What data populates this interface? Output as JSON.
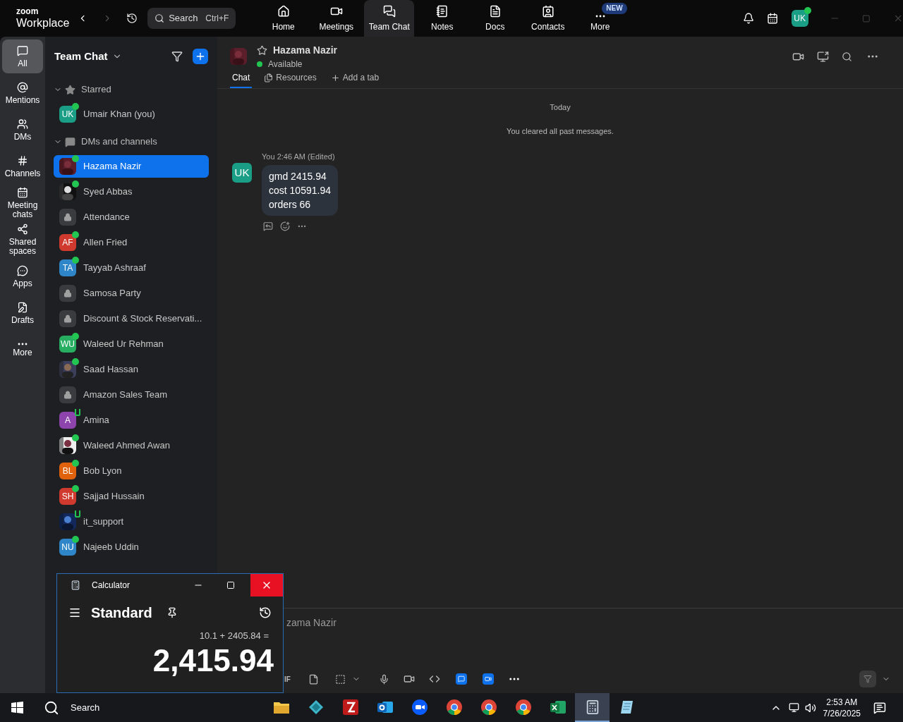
{
  "app": {
    "logo_top": "zoom",
    "logo_bottom": "Workplace"
  },
  "search": {
    "placeholder": "Search",
    "shortcut": "Ctrl+F"
  },
  "nav_tabs": [
    {
      "label": "Home",
      "selected": false
    },
    {
      "label": "Meetings",
      "selected": false
    },
    {
      "label": "Team Chat",
      "selected": true
    },
    {
      "label": "Notes",
      "selected": false
    },
    {
      "label": "Docs",
      "selected": false
    },
    {
      "label": "Contacts",
      "selected": false
    },
    {
      "label": "More",
      "selected": false,
      "badge": "NEW"
    }
  ],
  "profile": {
    "initials": "UK"
  },
  "rail": [
    {
      "label": "All",
      "selected": true
    },
    {
      "label": "Mentions",
      "selected": false
    },
    {
      "label": "DMs",
      "selected": false
    },
    {
      "label": "Channels",
      "selected": false
    },
    {
      "label": "Meeting chats",
      "selected": false
    },
    {
      "label": "Shared spaces",
      "selected": false
    },
    {
      "label": "Apps",
      "selected": false
    },
    {
      "label": "Drafts",
      "selected": false
    },
    {
      "label": "More",
      "selected": false
    }
  ],
  "sidebar": {
    "title": "Team Chat",
    "sections": [
      {
        "title": "Starred",
        "expanded": true,
        "items": [
          {
            "name": "Umair Khan (you)",
            "kind": "initials",
            "initials": "UK",
            "color": "#1a9e85",
            "online": true,
            "mobile": false,
            "selected": false
          }
        ]
      },
      {
        "title": "DMs and channels",
        "expanded": true,
        "items": [
          {
            "name": "Hazama Nazir",
            "online": true,
            "mobile": false,
            "selected": true
          },
          {
            "name": "Syed Abbas",
            "online": true,
            "mobile": false,
            "selected": false
          },
          {
            "name": "Attendance",
            "kind": "lock",
            "online": false,
            "mobile": false,
            "selected": false
          },
          {
            "name": "Allen Fried",
            "kind": "initials",
            "initials": "AF",
            "color": "#d0392e",
            "online": true,
            "mobile": false,
            "selected": false
          },
          {
            "name": "Tayyab Ashraaf",
            "kind": "initials",
            "initials": "TA",
            "color": "#2e86c8",
            "online": true,
            "mobile": false,
            "selected": false
          },
          {
            "name": "Samosa Party",
            "kind": "lock",
            "online": false,
            "mobile": false,
            "selected": false
          },
          {
            "name": "Discount & Stock Reservati...",
            "kind": "lock",
            "online": false,
            "mobile": false,
            "selected": false
          },
          {
            "name": "Waleed Ur Rehman",
            "kind": "initials",
            "initials": "WU",
            "color": "#27ae60",
            "online": true,
            "mobile": false,
            "selected": false
          },
          {
            "name": "Saad Hassan",
            "online": true,
            "mobile": false,
            "selected": false
          },
          {
            "name": "Amazon Sales Team",
            "kind": "lock",
            "online": false,
            "mobile": false,
            "selected": false
          },
          {
            "name": "Amina",
            "kind": "initials",
            "initials": "A",
            "color": "#8e44ad",
            "online": false,
            "mobile": true,
            "selected": false
          },
          {
            "name": "Waleed Ahmed Awan",
            "online": true,
            "mobile": false,
            "selected": false
          },
          {
            "name": "Bob Lyon",
            "kind": "initials",
            "initials": "BL",
            "color": "#e0620d",
            "online": true,
            "mobile": false,
            "selected": false
          },
          {
            "name": "Sajjad Hussain",
            "kind": "initials",
            "initials": "SH",
            "color": "#d0392e",
            "online": true,
            "mobile": false,
            "selected": false
          },
          {
            "name": "it_support",
            "online": false,
            "mobile": true,
            "selected": false
          },
          {
            "name": "Najeeb Uddin",
            "kind": "initials",
            "initials": "NU",
            "color": "#2e86c8",
            "online": true,
            "mobile": false,
            "selected": false
          }
        ]
      }
    ]
  },
  "chat": {
    "name": "Hazama Nazir",
    "presence": "Available",
    "starred": false,
    "tabs": [
      {
        "label": "Chat",
        "selected": true
      },
      {
        "label": "Resources",
        "selected": false
      },
      {
        "label": "Add a tab",
        "selected": false
      }
    ],
    "day": "Today",
    "notice": "You cleared all past messages.",
    "messages": [
      {
        "sender": "You",
        "time": "2:46 AM",
        "edited": "(Edited)",
        "initials": "UK",
        "lines": [
          "gmd 2415.94",
          "cost 10591.94",
          "orders 66"
        ]
      }
    ],
    "compose_placeholder": "zama Nazir",
    "compose_cut": "IF"
  },
  "calculator": {
    "title": "Calculator",
    "mode": "Standard",
    "expression": "10.1 + 2405.84 =",
    "result": "2,415.94"
  },
  "taskbar": {
    "search": "Search",
    "apps": [
      {
        "kind": "files",
        "selected": false
      },
      {
        "kind": "diamond",
        "selected": false
      },
      {
        "kind": "filezilla",
        "selected": false
      },
      {
        "kind": "outlook",
        "selected": false
      },
      {
        "kind": "zoom",
        "selected": false
      },
      {
        "kind": "chrome",
        "selected": false
      },
      {
        "kind": "chrome",
        "selected": false
      },
      {
        "kind": "chrome",
        "selected": false
      },
      {
        "kind": "excel",
        "selected": false
      },
      {
        "kind": "calculator",
        "selected": true
      },
      {
        "kind": "notepad",
        "selected": false
      }
    ],
    "time": "2:53 AM",
    "date": "7/26/2025"
  }
}
